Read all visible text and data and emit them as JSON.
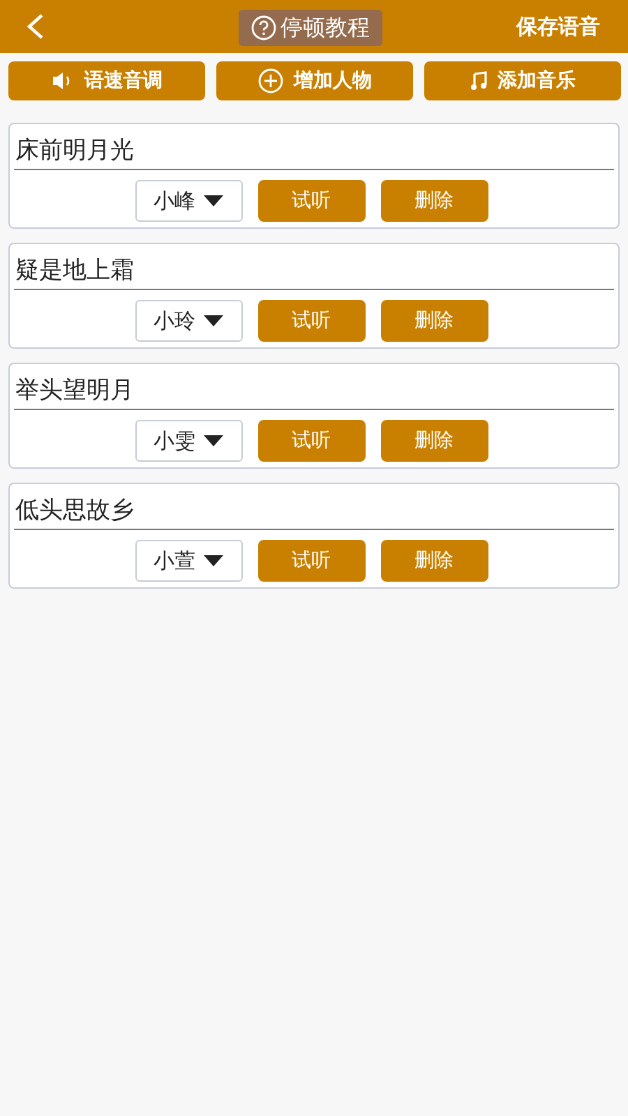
{
  "top_bar": {
    "tutorial_button": "停顿教程",
    "save_button": "保存语音"
  },
  "toolbar": [
    {
      "kind": "speaker",
      "label": "语速音调"
    },
    {
      "kind": "plus",
      "label": "增加人物"
    },
    {
      "kind": "music",
      "label": "添加音乐"
    }
  ],
  "lines": [
    {
      "text": "床前明月光",
      "voice": "小峰",
      "listen": "试听",
      "delete": "删除"
    },
    {
      "text": "疑是地上霜",
      "voice": "小玲",
      "listen": "试听",
      "delete": "删除"
    },
    {
      "text": "举头望明月",
      "voice": "小雯",
      "listen": "试听",
      "delete": "删除"
    },
    {
      "text": "低头思故乡",
      "voice": "小萱",
      "listen": "试听",
      "delete": "删除"
    }
  ]
}
